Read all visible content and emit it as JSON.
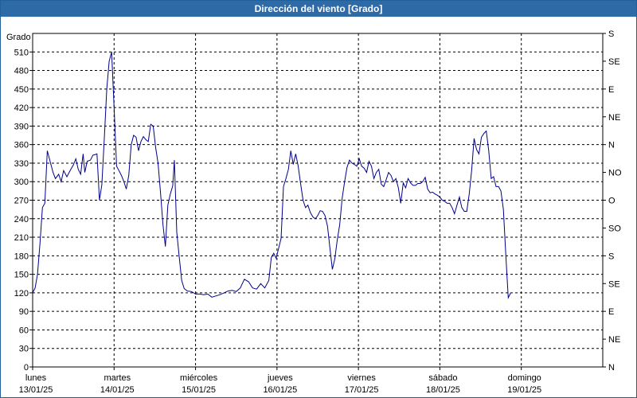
{
  "window": {
    "title": "Dirección del viento [Grado]"
  },
  "chart_data": {
    "type": "line",
    "title": "Dirección del viento [Grado]",
    "ylabel": "Grado",
    "ylim": [
      0,
      540
    ],
    "y_ticks": [
      0,
      30,
      60,
      90,
      120,
      150,
      180,
      210,
      240,
      270,
      300,
      330,
      360,
      390,
      420,
      450,
      480,
      510
    ],
    "right_axis_labels": [
      "N",
      "NE",
      "E",
      "SE",
      "S",
      "SO",
      "O",
      "NO",
      "N",
      "NE",
      "E",
      "SE",
      "S"
    ],
    "right_axis_values": [
      0,
      45,
      90,
      135,
      180,
      225,
      270,
      315,
      360,
      405,
      450,
      495,
      540
    ],
    "xlim": [
      0,
      7
    ],
    "x_ticks": [
      {
        "day": "lunes",
        "date": "13/01/25"
      },
      {
        "day": "martes",
        "date": "14/01/25"
      },
      {
        "day": "miércoles",
        "date": "15/01/25"
      },
      {
        "day": "jueves",
        "date": "16/01/25"
      },
      {
        "day": "viernes",
        "date": "17/01/25"
      },
      {
        "day": "sábado",
        "date": "18/01/25"
      },
      {
        "day": "domingo",
        "date": "19/01/25"
      }
    ],
    "grid": true,
    "line_color": "#00008b",
    "series": [
      {
        "points": [
          [
            0.0,
            120
          ],
          [
            0.03,
            128
          ],
          [
            0.06,
            150
          ],
          [
            0.09,
            200
          ],
          [
            0.12,
            258
          ],
          [
            0.15,
            265
          ],
          [
            0.18,
            350
          ],
          [
            0.21,
            335
          ],
          [
            0.25,
            315
          ],
          [
            0.28,
            305
          ],
          [
            0.32,
            312
          ],
          [
            0.35,
            300
          ],
          [
            0.38,
            318
          ],
          [
            0.42,
            308
          ],
          [
            0.46,
            318
          ],
          [
            0.5,
            327
          ],
          [
            0.53,
            337
          ],
          [
            0.56,
            320
          ],
          [
            0.59,
            312
          ],
          [
            0.62,
            345
          ],
          [
            0.64,
            315
          ],
          [
            0.67,
            333
          ],
          [
            0.71,
            335
          ],
          [
            0.74,
            343
          ],
          [
            0.77,
            344
          ],
          [
            0.79,
            345
          ],
          [
            0.82,
            270
          ],
          [
            0.85,
            295
          ],
          [
            0.88,
            370
          ],
          [
            0.91,
            450
          ],
          [
            0.94,
            495
          ],
          [
            0.97,
            510
          ],
          [
            1.0,
            420
          ],
          [
            1.03,
            325
          ],
          [
            1.06,
            318
          ],
          [
            1.09,
            310
          ],
          [
            1.12,
            300
          ],
          [
            1.15,
            288
          ],
          [
            1.18,
            310
          ],
          [
            1.21,
            360
          ],
          [
            1.24,
            375
          ],
          [
            1.27,
            372
          ],
          [
            1.3,
            350
          ],
          [
            1.33,
            365
          ],
          [
            1.36,
            373
          ],
          [
            1.39,
            368
          ],
          [
            1.42,
            365
          ],
          [
            1.45,
            393
          ],
          [
            1.48,
            390
          ],
          [
            1.51,
            355
          ],
          [
            1.54,
            330
          ],
          [
            1.57,
            282
          ],
          [
            1.6,
            230
          ],
          [
            1.63,
            195
          ],
          [
            1.66,
            262
          ],
          [
            1.69,
            280
          ],
          [
            1.72,
            293
          ],
          [
            1.74,
            335
          ],
          [
            1.77,
            218
          ],
          [
            1.8,
            178
          ],
          [
            1.83,
            140
          ],
          [
            1.86,
            127
          ],
          [
            1.9,
            123
          ],
          [
            1.95,
            122
          ],
          [
            2.0,
            118
          ],
          [
            2.05,
            118
          ],
          [
            2.1,
            117
          ],
          [
            2.15,
            118
          ],
          [
            2.2,
            113
          ],
          [
            2.25,
            115
          ],
          [
            2.3,
            117
          ],
          [
            2.35,
            120
          ],
          [
            2.4,
            123
          ],
          [
            2.45,
            124
          ],
          [
            2.5,
            122
          ],
          [
            2.55,
            128
          ],
          [
            2.6,
            142
          ],
          [
            2.65,
            138
          ],
          [
            2.7,
            128
          ],
          [
            2.75,
            126
          ],
          [
            2.8,
            135
          ],
          [
            2.85,
            128
          ],
          [
            2.9,
            140
          ],
          [
            2.93,
            177
          ],
          [
            2.96,
            184
          ],
          [
            2.99,
            176
          ],
          [
            3.02,
            192
          ],
          [
            3.05,
            208
          ],
          [
            3.08,
            292
          ],
          [
            3.11,
            305
          ],
          [
            3.14,
            320
          ],
          [
            3.17,
            350
          ],
          [
            3.2,
            328
          ],
          [
            3.23,
            345
          ],
          [
            3.26,
            325
          ],
          [
            3.29,
            297
          ],
          [
            3.32,
            270
          ],
          [
            3.35,
            258
          ],
          [
            3.38,
            262
          ],
          [
            3.41,
            250
          ],
          [
            3.44,
            243
          ],
          [
            3.47,
            240
          ],
          [
            3.5,
            245
          ],
          [
            3.53,
            253
          ],
          [
            3.56,
            252
          ],
          [
            3.59,
            245
          ],
          [
            3.62,
            228
          ],
          [
            3.65,
            193
          ],
          [
            3.68,
            158
          ],
          [
            3.71,
            175
          ],
          [
            3.74,
            205
          ],
          [
            3.77,
            230
          ],
          [
            3.8,
            273
          ],
          [
            3.83,
            300
          ],
          [
            3.86,
            323
          ],
          [
            3.89,
            335
          ],
          [
            3.92,
            330
          ],
          [
            3.95,
            328
          ],
          [
            3.98,
            325
          ],
          [
            4.01,
            337
          ],
          [
            4.04,
            325
          ],
          [
            4.07,
            322
          ],
          [
            4.1,
            315
          ],
          [
            4.13,
            333
          ],
          [
            4.16,
            325
          ],
          [
            4.19,
            305
          ],
          [
            4.22,
            315
          ],
          [
            4.25,
            320
          ],
          [
            4.28,
            296
          ],
          [
            4.31,
            292
          ],
          [
            4.34,
            303
          ],
          [
            4.37,
            315
          ],
          [
            4.4,
            310
          ],
          [
            4.43,
            300
          ],
          [
            4.46,
            305
          ],
          [
            4.49,
            290
          ],
          [
            4.52,
            265
          ],
          [
            4.55,
            298
          ],
          [
            4.58,
            290
          ],
          [
            4.61,
            305
          ],
          [
            4.64,
            298
          ],
          [
            4.67,
            294
          ],
          [
            4.7,
            294
          ],
          [
            4.73,
            297
          ],
          [
            4.76,
            297
          ],
          [
            4.79,
            300
          ],
          [
            4.82,
            307
          ],
          [
            4.85,
            288
          ],
          [
            4.88,
            282
          ],
          [
            4.91,
            283
          ],
          [
            4.94,
            280
          ],
          [
            4.97,
            278
          ],
          [
            5.0,
            275
          ],
          [
            5.03,
            270
          ],
          [
            5.06,
            268
          ],
          [
            5.09,
            265
          ],
          [
            5.12,
            265
          ],
          [
            5.15,
            258
          ],
          [
            5.18,
            248
          ],
          [
            5.21,
            262
          ],
          [
            5.24,
            275
          ],
          [
            5.27,
            258
          ],
          [
            5.3,
            252
          ],
          [
            5.33,
            252
          ],
          [
            5.36,
            280
          ],
          [
            5.39,
            318
          ],
          [
            5.42,
            370
          ],
          [
            5.45,
            352
          ],
          [
            5.48,
            345
          ],
          [
            5.51,
            372
          ],
          [
            5.54,
            378
          ],
          [
            5.57,
            382
          ],
          [
            5.6,
            350
          ],
          [
            5.63,
            305
          ],
          [
            5.66,
            308
          ],
          [
            5.69,
            292
          ],
          [
            5.72,
            292
          ],
          [
            5.75,
            285
          ],
          [
            5.78,
            255
          ],
          [
            5.81,
            180
          ],
          [
            5.84,
            112
          ],
          [
            5.87,
            120
          ]
        ]
      }
    ]
  }
}
